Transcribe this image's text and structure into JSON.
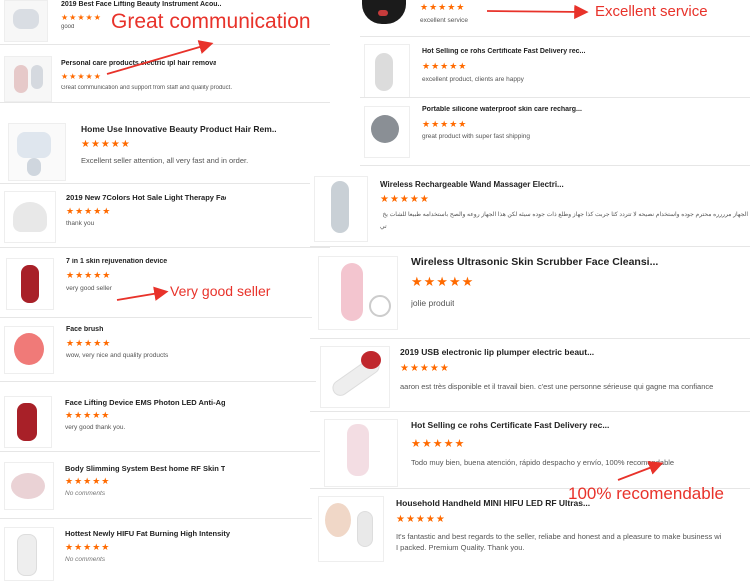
{
  "colors": {
    "star": "#ff6a00",
    "annotation": "#e8322a"
  },
  "star_icon": "star-icon",
  "annotations": {
    "great_communication": "Great communication",
    "excellent_service": "Excellent service",
    "very_good_seller": "Very good seller",
    "recomendable": "100% recomendable"
  },
  "left": [
    {
      "title": "2019 Best Face Lifting Beauty Instrument Acou...",
      "stars": "★★★★★",
      "rating": 5,
      "review": "good"
    },
    {
      "title": "Personal care products electric ipl hair removal...",
      "stars": "★★★★★",
      "rating": 5,
      "review": "Great communication and support from staff and quality product."
    },
    {
      "title": "Home Use Innovative Beauty Product Hair Rem...",
      "stars": "★★★★★",
      "rating": 5,
      "review": "Excellent seller attention, all very fast and in order."
    },
    {
      "title": "2019 New 7Colors Hot Sale Light Therapy Faci...",
      "stars": "★★★★★",
      "rating": 5,
      "review": "thank you"
    },
    {
      "title": "7 in 1 skin rejuvenation device",
      "stars": "★★★★★",
      "rating": 5,
      "review": "very good seller"
    },
    {
      "title": "Face brush",
      "stars": "★★★★★",
      "rating": 5,
      "review": "wow, very nice and quality products"
    },
    {
      "title": "Face Lifting Device EMS Photon LED Anti-Agin...",
      "stars": "★★★★★",
      "rating": 5,
      "review": "very good thank you."
    },
    {
      "title": "Body Slimming System Best home RF Skin Tig...",
      "stars": "★★★★★",
      "rating": 5,
      "review": "No comments"
    },
    {
      "title": "Hottest Newly HIFU Fat Burning High Intensity ...",
      "stars": "★★★★★",
      "rating": 5,
      "review": "No comments"
    }
  ],
  "right": [
    {
      "title": "",
      "stars": "★★★★★",
      "rating": 5,
      "review": "excellent service"
    },
    {
      "title": "Hot Selling ce rohs Certificate Fast Delivery rec...",
      "stars": "★★★★★",
      "rating": 5,
      "review": "excellent product, clients are happy"
    },
    {
      "title": "Portable silicone waterproof skin care recharg...",
      "stars": "★★★★★",
      "rating": 5,
      "review": "great product with super fast shipping"
    },
    {
      "title": "Wireless Rechargeable Wand Massager Electri...",
      "stars": "★★★★★",
      "rating": 5,
      "review": "الجهاز مرررره محترم جوده واستخدام نصيحه لا تتردد كثا جربت كذا جهاز وطلع ذات جوده سيئه لكن هذا الجهاز روعه والصح باستخدامه طبيعاً للشات يخ",
      "review2": "تي"
    },
    {
      "title": "Wireless Ultrasonic Skin Scrubber Face Cleansi...",
      "stars": "★★★★★",
      "rating": 5,
      "review": "jolie produit"
    },
    {
      "title": "2019 USB electronic lip plumper electric beaut...",
      "stars": "★★★★★",
      "rating": 5,
      "review": "aaron est très disponible et il travail bien. c'est une personne sérieuse qui gagne ma confiance"
    },
    {
      "title": "Hot Selling ce rohs Certificate Fast Delivery rec...",
      "stars": "★★★★★",
      "rating": 5,
      "review": "Todo muy bien, buena atención, rápido despacho y envío, 100% recomendable"
    },
    {
      "title": "Household Handheld MINI HIFU LED RF Ultras...",
      "stars": "★★★★★",
      "rating": 5,
      "review": "It's fantastic and best regards to the seller, reliabe and honest and a pleasure to make business wi",
      "review2": "I packed. Premium Quality. Thank you."
    }
  ]
}
